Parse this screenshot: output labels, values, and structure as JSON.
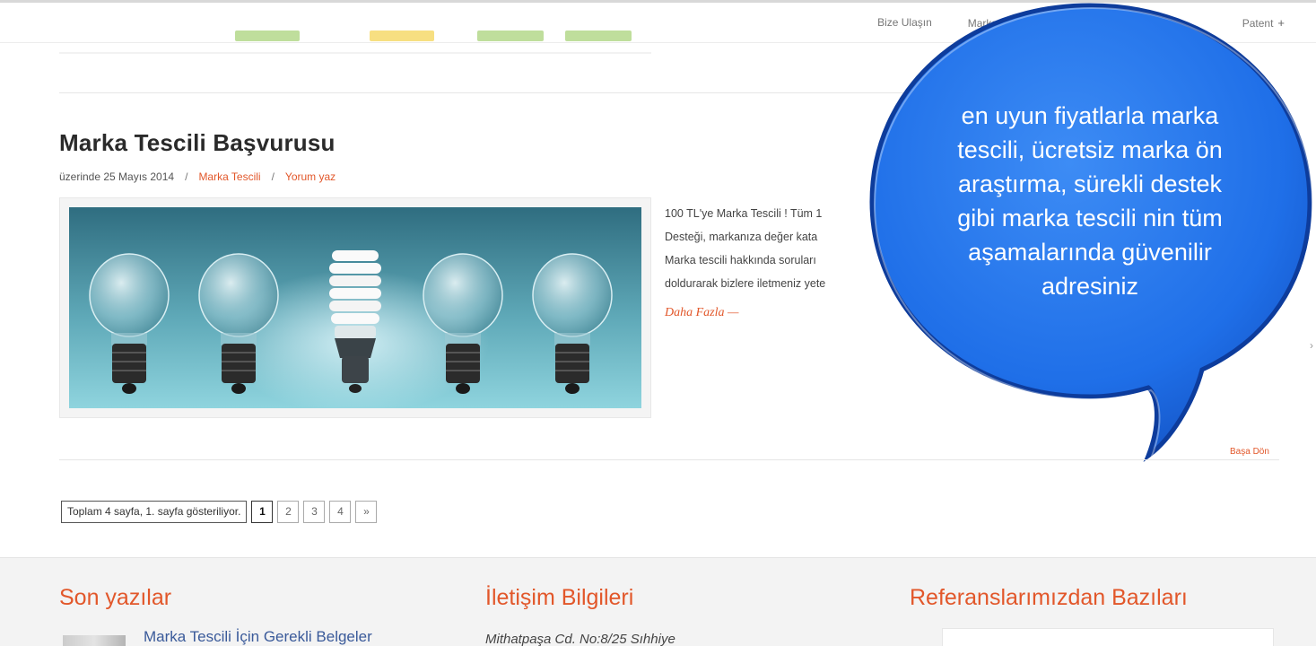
{
  "colors": {
    "accent": "#e2572a",
    "link_blue": "#3a5a9a",
    "bubble_blue": "#1f6fe8",
    "bubble_edge": "#0d3c9c"
  },
  "nav": {
    "items": [
      {
        "label": "Bize Ulaşın",
        "plus": ""
      },
      {
        "label": "Marka",
        "plus": "+"
      },
      {
        "label": "Patent",
        "plus": "+"
      }
    ]
  },
  "post": {
    "title": "Marka Tescili Başvurusu",
    "date": "üzerinde 25 Mayıs 2014",
    "category": "Marka Tescili",
    "comment": "Yorum yaz",
    "excerpt_lines": [
      "100 TL'ye Marka Tescili ! Tüm 1",
      "Desteği, markanıza değer kata",
      "Marka tescili hakkında soruları",
      "doldurarak bizlere iletmeniz yete"
    ],
    "read_more": "Daha Fazla —",
    "back_to_top": "Başa Dön"
  },
  "pagination": {
    "info": "Toplam 4 sayfa, 1. sayfa gösteriliyor.",
    "pages": [
      "1",
      "2",
      "3",
      "4",
      "»"
    ],
    "current": "1"
  },
  "bubble": {
    "lines": [
      "en uyun fiyatlarla marka",
      "tescili, ücretsiz marka ön",
      "araştırma, sürekli destek",
      "gibi marka tescili nin tüm",
      "aşamalarında güvenilir",
      "adresiniz"
    ]
  },
  "footer": {
    "recent_title": "Son yazılar",
    "recent_item": "Marka Tescili İçin Gerekli Belgeler",
    "contact_title": "İletişim Bilgileri",
    "address": "Mithatpaşa Cd. No:8/25 Sıhhiye",
    "references_title": "Referanslarımızdan Bazıları"
  }
}
